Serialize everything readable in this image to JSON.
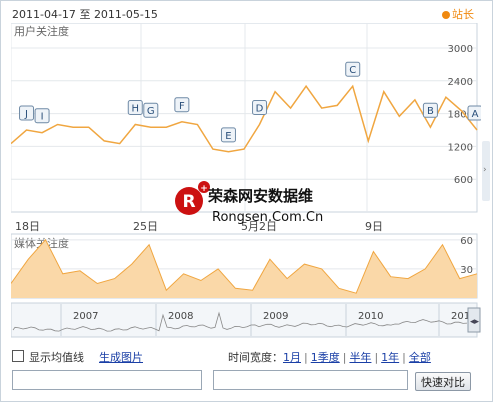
{
  "header": {
    "start_date": "2011-04-17",
    "range_sep": "至",
    "end_date": "2011-05-15",
    "site_label": "站长"
  },
  "colors": {
    "user_line": "#f0a640",
    "media_fill": "#fad8a8",
    "media_line": "#f0a640",
    "grid": "#e4e8ec",
    "border": "#c9d3dc",
    "link": "#1a3fa6",
    "watermark_red": "#cc1111"
  },
  "user_chart": {
    "title": "用户关注度",
    "y_ticks": [
      "3000",
      "2400",
      "1800",
      "1200",
      "600"
    ],
    "x_labels": [
      "18日",
      "25日",
      "5月2日",
      "9日"
    ],
    "events": [
      "J",
      "I",
      "H",
      "G",
      "F",
      "E",
      "D",
      "C",
      "B",
      "A"
    ],
    "values": [
      1250,
      1500,
      1450,
      1600,
      1550,
      1550,
      1300,
      1250,
      1600,
      1550,
      1550,
      1650,
      1600,
      1150,
      1100,
      1150,
      1600,
      2200,
      1900,
      2300,
      1900,
      1950,
      2300,
      1300,
      2200,
      1750,
      2050,
      1550,
      2100,
      1850,
      1500
    ]
  },
  "media_chart": {
    "title": "媒体关注度",
    "y_ticks": [
      "60",
      "30"
    ],
    "values": [
      15,
      40,
      60,
      25,
      28,
      15,
      20,
      35,
      55,
      8,
      25,
      18,
      30,
      10,
      8,
      40,
      20,
      35,
      30,
      10,
      5,
      48,
      22,
      20,
      30,
      55,
      20,
      25
    ]
  },
  "overview": {
    "years": [
      "2007",
      "2008",
      "2009",
      "2010",
      "201"
    ]
  },
  "watermark": {
    "logo_letter": "R",
    "name": "荣森网安数据维",
    "domain": "Rongsen.Com.Cn"
  },
  "controls": {
    "avg_label": "显示均值线",
    "gen_image": "生成图片",
    "time_width_label": "时间宽度：",
    "time_options": [
      "1月",
      "1季度",
      "半年",
      "1年",
      "全部"
    ],
    "input1_value": "",
    "input2_value": "",
    "compare_button": "快速对比"
  }
}
